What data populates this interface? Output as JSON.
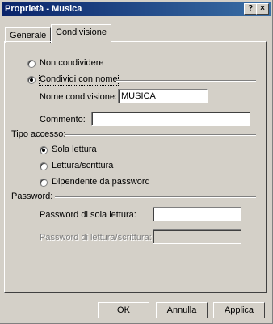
{
  "window": {
    "title": "Proprietà - Musica",
    "help_button": "?",
    "close_button": "×"
  },
  "tabs": [
    {
      "label": "Generale",
      "active": false
    },
    {
      "label": "Condivisione",
      "active": true
    }
  ],
  "sharing": {
    "not_shared_label": "Non condividere",
    "shared_as_label": "Condividi con nome",
    "selected": "shared_as"
  },
  "share_name": {
    "label": "Nome condivisione:",
    "value": "MUSICA"
  },
  "comment": {
    "label": "Commento:",
    "value": ""
  },
  "access_type": {
    "group_label": "Tipo accesso:",
    "options": [
      {
        "label": "Sola lettura",
        "checked": true
      },
      {
        "label": "Lettura/scrittura",
        "checked": false
      },
      {
        "label": "Dipendente da password",
        "checked": false
      }
    ]
  },
  "password": {
    "group_label": "Password:",
    "read_only_label": "Password di sola lettura:",
    "read_only_value": "",
    "full_access_label": "Password di lettura/scrittura:",
    "full_access_value": ""
  },
  "buttons": {
    "ok": "OK",
    "cancel": "Annulla",
    "apply": "Applica"
  },
  "colors": {
    "titlebar_start": "#0a246a",
    "titlebar_end": "#3a6ea5",
    "dialog_face": "#d4d0c8"
  }
}
